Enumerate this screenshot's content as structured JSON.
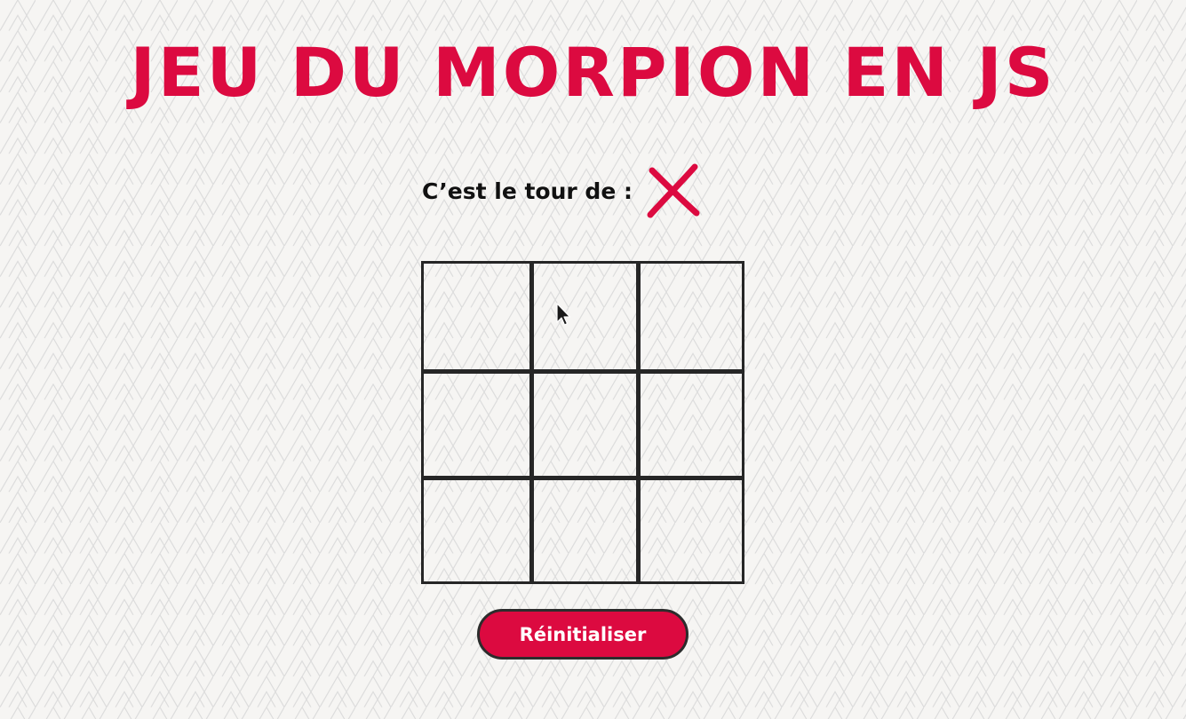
{
  "page": {
    "title": "JEU DU MORPION EN JS",
    "turn_label": "C’est le tour de :",
    "current_player_icon": "x-mark-icon",
    "reset_label": "Réinitialiser"
  },
  "board": {
    "rows": 3,
    "cols": 3,
    "cells": [
      "",
      "",
      "",
      "",
      "",
      "",
      "",
      "",
      ""
    ]
  },
  "colors": {
    "accent": "#dc0a40",
    "grid_lines": "#262626",
    "background": "#f6f5f3",
    "pattern": "#dcdcdc"
  }
}
